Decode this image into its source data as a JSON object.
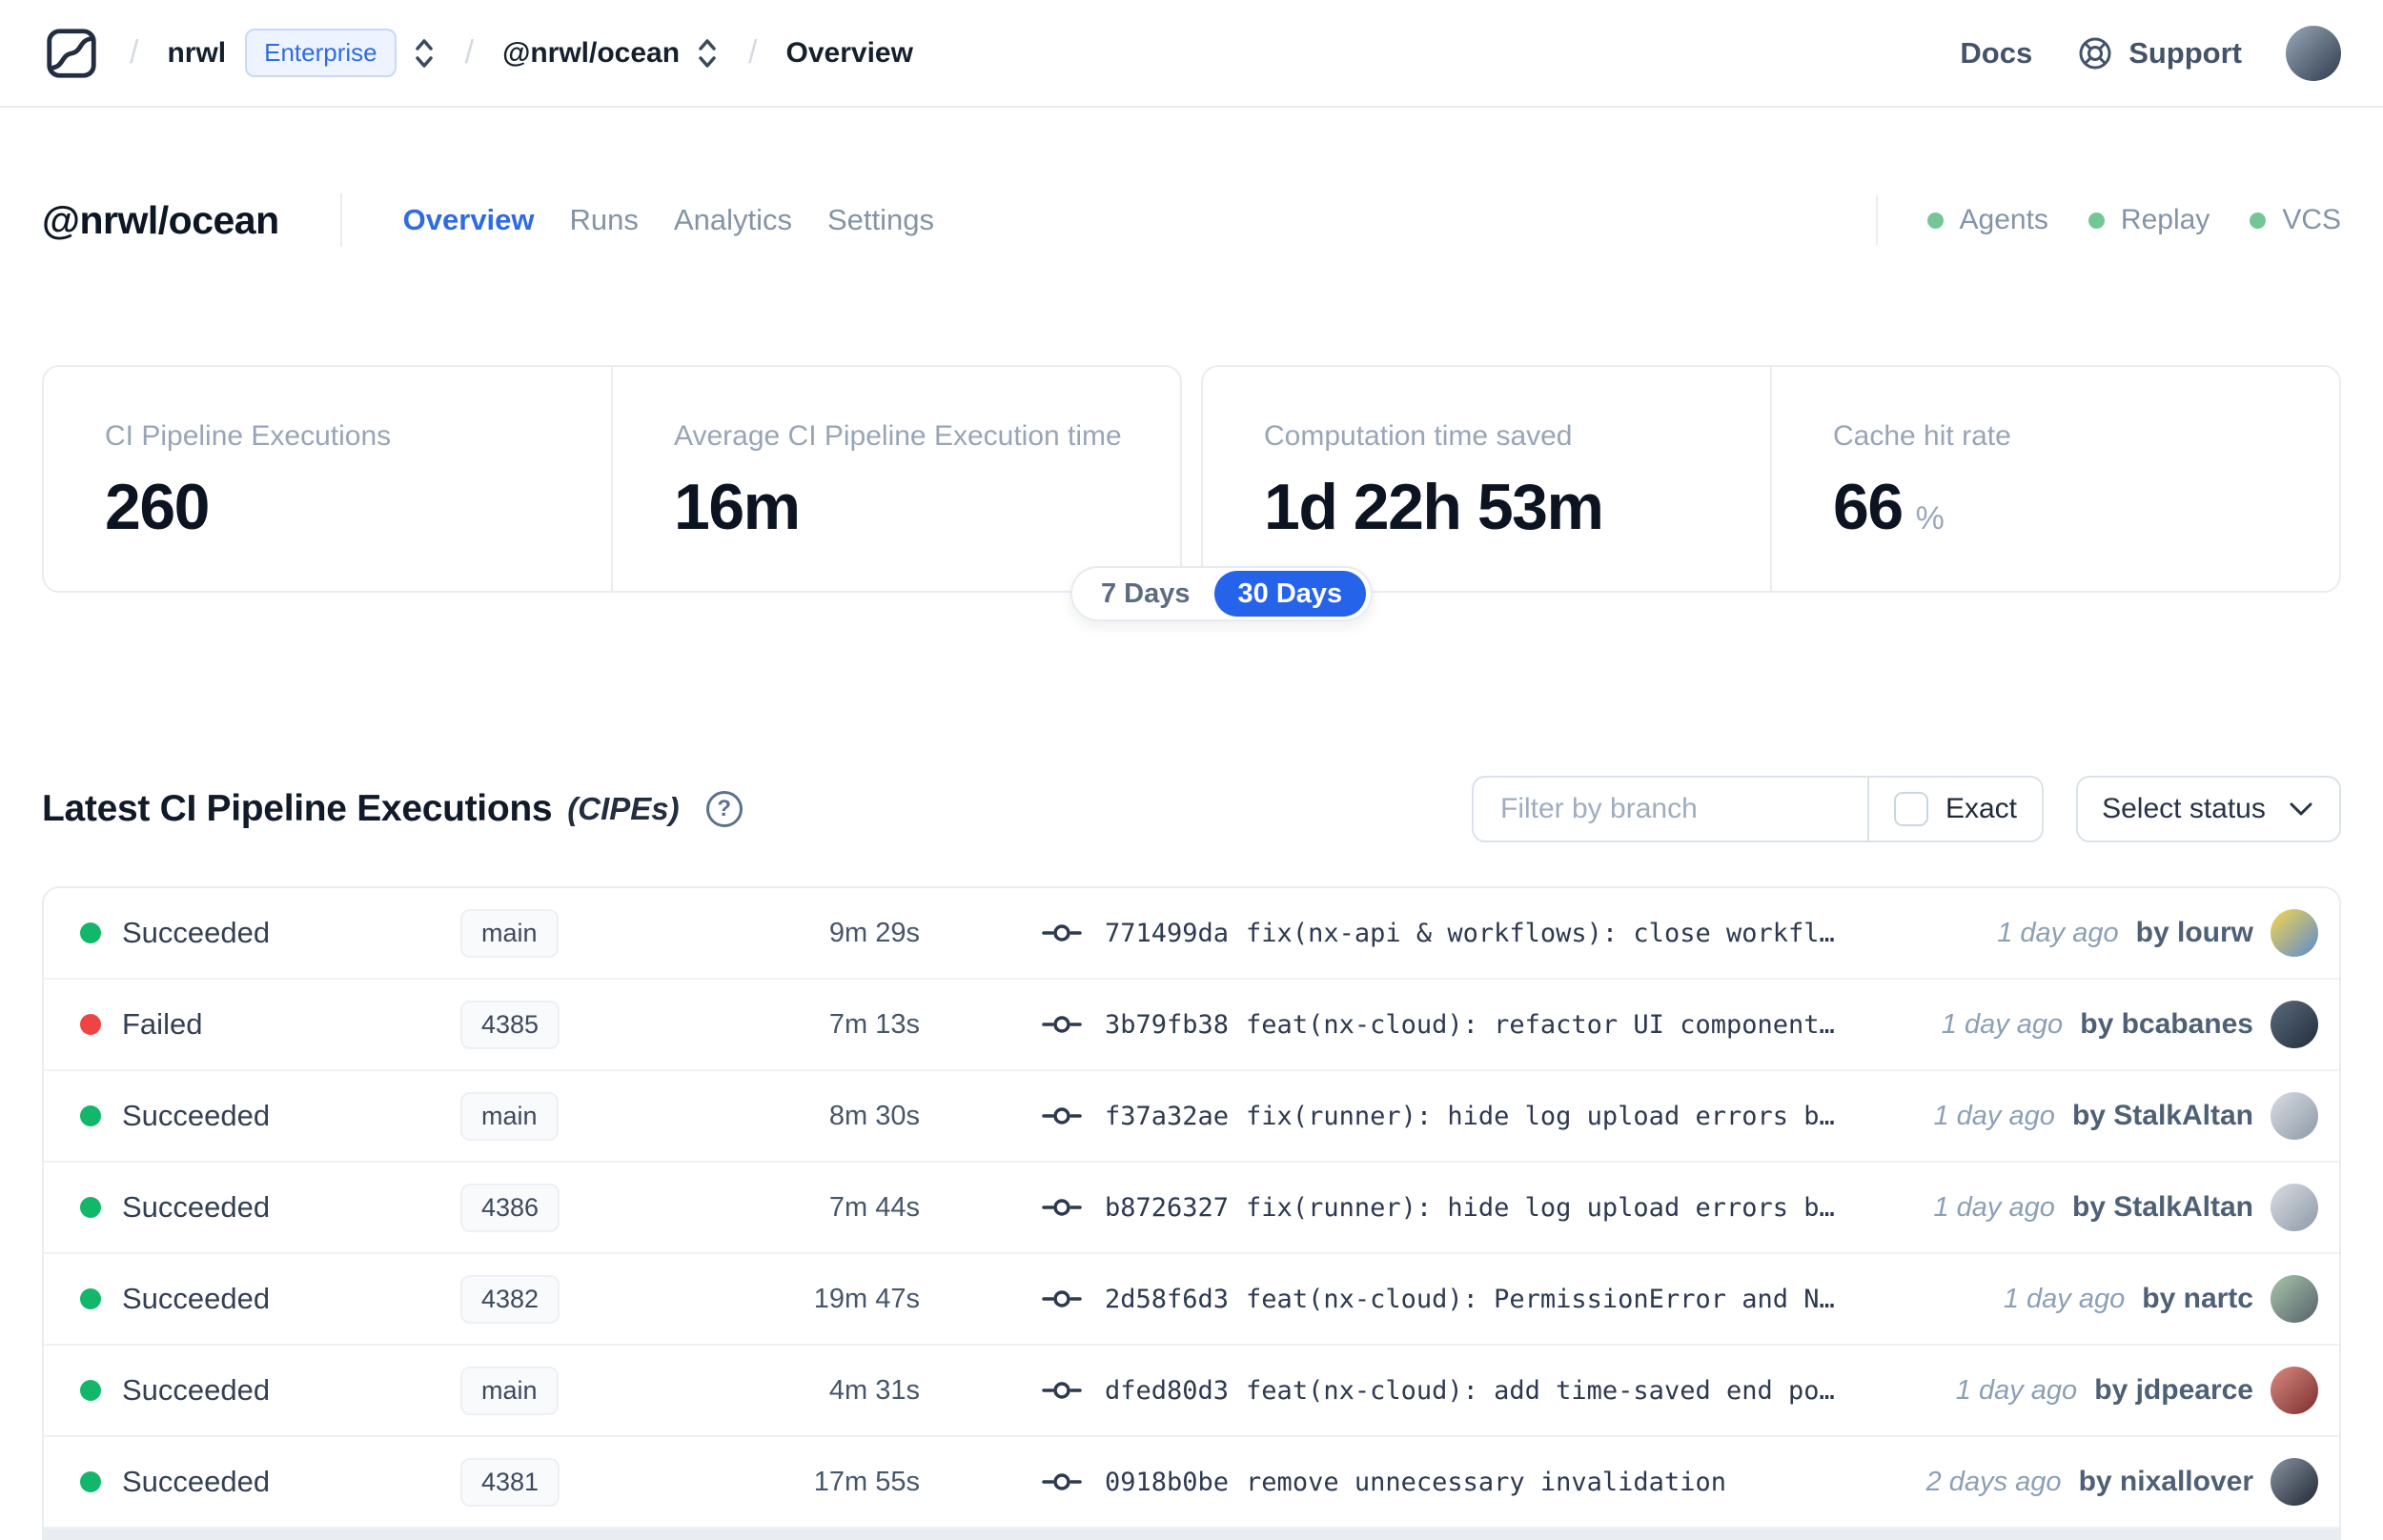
{
  "nav": {
    "separator": "/",
    "breadcrumb": {
      "org": "nrwl",
      "badge": "Enterprise",
      "workspace": "@nrwl/ocean",
      "page": "Overview"
    },
    "links": {
      "docs": "Docs",
      "support": "Support"
    },
    "avatar_colors": [
      "#9aa8b8",
      "#2f3b4c"
    ]
  },
  "header": {
    "title": "@nrwl/ocean",
    "tabs": [
      {
        "label": "Overview",
        "active": true
      },
      {
        "label": "Runs",
        "active": false
      },
      {
        "label": "Analytics",
        "active": false
      },
      {
        "label": "Settings",
        "active": false
      }
    ],
    "statuses": [
      {
        "label": "Agents"
      },
      {
        "label": "Replay"
      },
      {
        "label": "VCS"
      }
    ]
  },
  "stats": {
    "cards": [
      {
        "label": "CI Pipeline Executions",
        "value": "260"
      },
      {
        "label": "Average CI Pipeline Execution time",
        "value": "16m"
      },
      {
        "label": "Computation time saved",
        "value": "1d 22h 53m"
      },
      {
        "label": "Cache hit rate",
        "value": "66",
        "suffix": "%"
      }
    ],
    "range": {
      "options": [
        {
          "label": "7 Days",
          "active": false
        },
        {
          "label": "30 Days",
          "active": true
        }
      ],
      "selected": "30 Days"
    }
  },
  "section": {
    "title": "Latest CI Pipeline Executions",
    "subtitle": "(CIPEs)",
    "help": "?",
    "filter_placeholder": "Filter by branch",
    "exact_label": "Exact",
    "status_select_label": "Select status"
  },
  "table": {
    "rows": [
      {
        "status": "Succeeded",
        "kind": "success",
        "branch": "main",
        "duration": "9m 29s",
        "commit_hash": "771499da",
        "commit_message": "fix(nx-api & workflows): close workfl…",
        "ago": "1 day ago",
        "author": "by lourw",
        "avatar": [
          "#f6d64a",
          "#5b8ad6"
        ]
      },
      {
        "status": "Failed",
        "kind": "failed",
        "branch": "4385",
        "duration": "7m 13s",
        "commit_hash": "3b79fb38",
        "commit_message": "feat(nx-cloud): refactor UI component…",
        "ago": "1 day ago",
        "author": "by bcabanes",
        "avatar": [
          "#5b6b7d",
          "#232d3a"
        ]
      },
      {
        "status": "Succeeded",
        "kind": "success",
        "branch": "main",
        "duration": "8m 30s",
        "commit_hash": "f37a32ae",
        "commit_message": "fix(runner): hide log upload errors b…",
        "ago": "1 day ago",
        "author": "by StalkAltan",
        "avatar": [
          "#d9dde2",
          "#8d99a8"
        ]
      },
      {
        "status": "Succeeded",
        "kind": "success",
        "branch": "4386",
        "duration": "7m 44s",
        "commit_hash": "b8726327",
        "commit_message": "fix(runner): hide log upload errors b…",
        "ago": "1 day ago",
        "author": "by StalkAltan",
        "avatar": [
          "#d9dde2",
          "#8d99a8"
        ]
      },
      {
        "status": "Succeeded",
        "kind": "success",
        "branch": "4382",
        "duration": "19m 47s",
        "commit_hash": "2d58f6d3",
        "commit_message": "feat(nx-cloud): PermissionError and N…",
        "ago": "1 day ago",
        "author": "by nartc",
        "avatar": [
          "#a9c6a8",
          "#55606b"
        ]
      },
      {
        "status": "Succeeded",
        "kind": "success",
        "branch": "main",
        "duration": "4m 31s",
        "commit_hash": "dfed80d3",
        "commit_message": "feat(nx-cloud): add time-saved end po…",
        "ago": "1 day ago",
        "author": "by jdpearce",
        "avatar": [
          "#d98a80",
          "#7a2e2e"
        ]
      },
      {
        "status": "Succeeded",
        "kind": "success",
        "branch": "4381",
        "duration": "17m 55s",
        "commit_hash": "0918b0be",
        "commit_message": "remove unnecessary invalidation",
        "ago": "2 days ago",
        "author": "by nixallover",
        "avatar": [
          "#8b95a1",
          "#1f2834"
        ]
      }
    ]
  },
  "colors": {
    "accent": "#2563eb",
    "success": "#12b76a",
    "failed": "#ef4444",
    "header_status_dot": "#74c795"
  }
}
